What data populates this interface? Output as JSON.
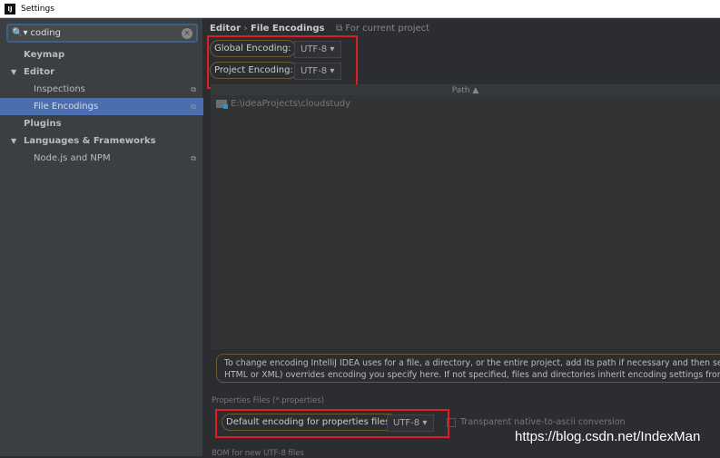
{
  "window": {
    "title": "Settings"
  },
  "sidebar": {
    "search_value": "coding",
    "items": [
      {
        "label": "Keymap"
      },
      {
        "label": "Editor"
      },
      {
        "label": "Inspections"
      },
      {
        "label": "File Encodings"
      },
      {
        "label": "Plugins"
      },
      {
        "label": "Languages & Frameworks"
      },
      {
        "label": "Node.js and NPM"
      }
    ]
  },
  "main": {
    "breadcrumb": {
      "parent": "Editor",
      "sep": "›",
      "current": "File Encodings"
    },
    "for_current_project": "For current project",
    "global_encoding": {
      "label": "Global Encoding:",
      "value": "UTF-8"
    },
    "project_encoding": {
      "label": "Project Encoding:",
      "value": "UTF-8"
    },
    "table": {
      "header": "Path ▲",
      "rows": [
        {
          "path": "E:\\ideaProjects\\cloudstudy"
        }
      ]
    },
    "info_line1": "To change encoding IntelliJ IDEA uses for a file, a directory, or the entire project, add its path if necessary and then select encoding",
    "info_line2": "HTML or XML) overrides encoding you specify here. If not specified, files and directories inherit encoding settings from the parent",
    "properties_section": "Properties Files (*.properties)",
    "properties_encoding": {
      "label": "Default encoding for properties files:",
      "value": "UTF-8"
    },
    "transparent_label": "Transparent native-to-ascii conversion",
    "bom_section": "BOM for new UTF-8 files"
  },
  "watermark": "https://blog.csdn.net/IndexMan",
  "colors": {
    "selection": "#4b6eaf",
    "highlight_box": "#e31b23"
  }
}
